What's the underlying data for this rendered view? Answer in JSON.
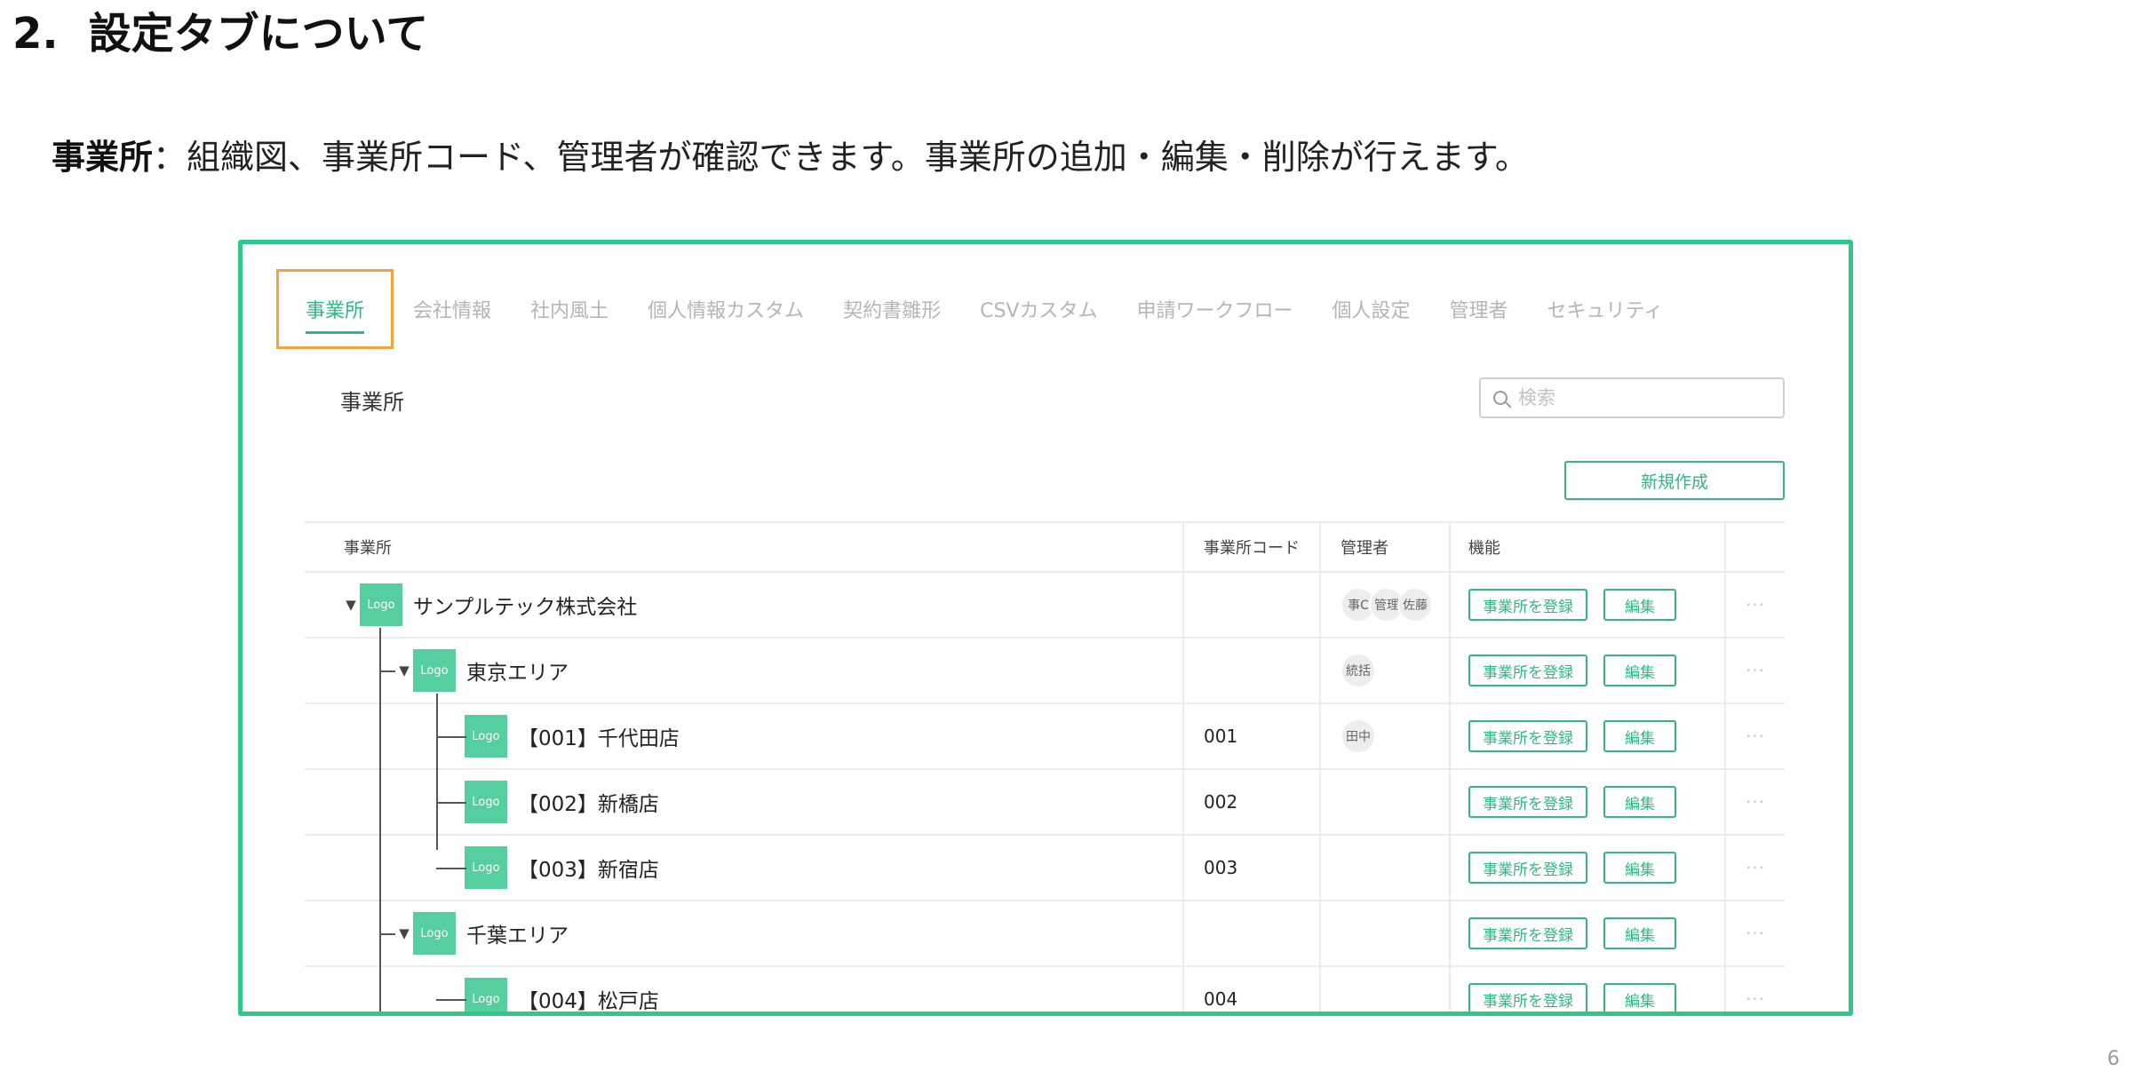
{
  "slide": {
    "number": "2.",
    "title": "設定タブについて",
    "intro_term": "事業所",
    "intro_text": "：組織図、事業所コード、管理者が確認できます。事業所の追加・編集・削除が行えます。",
    "page_number": "6"
  },
  "ui": {
    "tabs": [
      {
        "label": "事業所",
        "active": true
      },
      {
        "label": "会社情報"
      },
      {
        "label": "社内風土"
      },
      {
        "label": "個人情報カスタム"
      },
      {
        "label": "契約書雛形"
      },
      {
        "label": "CSVカスタム"
      },
      {
        "label": "申請ワークフロー"
      },
      {
        "label": "個人設定"
      },
      {
        "label": "管理者"
      },
      {
        "label": "セキュリティ"
      }
    ],
    "section_label": "事業所",
    "search_placeholder": "検索",
    "new_button": "新規作成",
    "table": {
      "headers": {
        "name": "事業所",
        "code": "事業所コード",
        "admin": "管理者",
        "func": "機能"
      },
      "register_label": "事業所を登録",
      "edit_label": "編集",
      "more_label": "···",
      "logo_label": "Logo",
      "rows": [
        {
          "name": "サンプルテック株式会社",
          "code": "",
          "admins": [
            "事C",
            "管理",
            "佐藤"
          ],
          "level": 0,
          "caret": "▼"
        },
        {
          "name": "東京エリア",
          "code": "",
          "admins": [
            "統括"
          ],
          "level": 1,
          "caret": "▼"
        },
        {
          "name": "【001】千代田店",
          "code": "001",
          "admins": [
            "田中"
          ],
          "level": 2,
          "caret": ""
        },
        {
          "name": "【002】新橋店",
          "code": "002",
          "admins": [],
          "level": 2,
          "caret": ""
        },
        {
          "name": "【003】新宿店",
          "code": "003",
          "admins": [],
          "level": 2,
          "caret": ""
        },
        {
          "name": "千葉エリア",
          "code": "",
          "admins": [],
          "level": 1,
          "caret": "▼"
        },
        {
          "name": "【004】松戸店",
          "code": "004",
          "admins": [],
          "level": 2,
          "caret": ""
        }
      ]
    }
  }
}
